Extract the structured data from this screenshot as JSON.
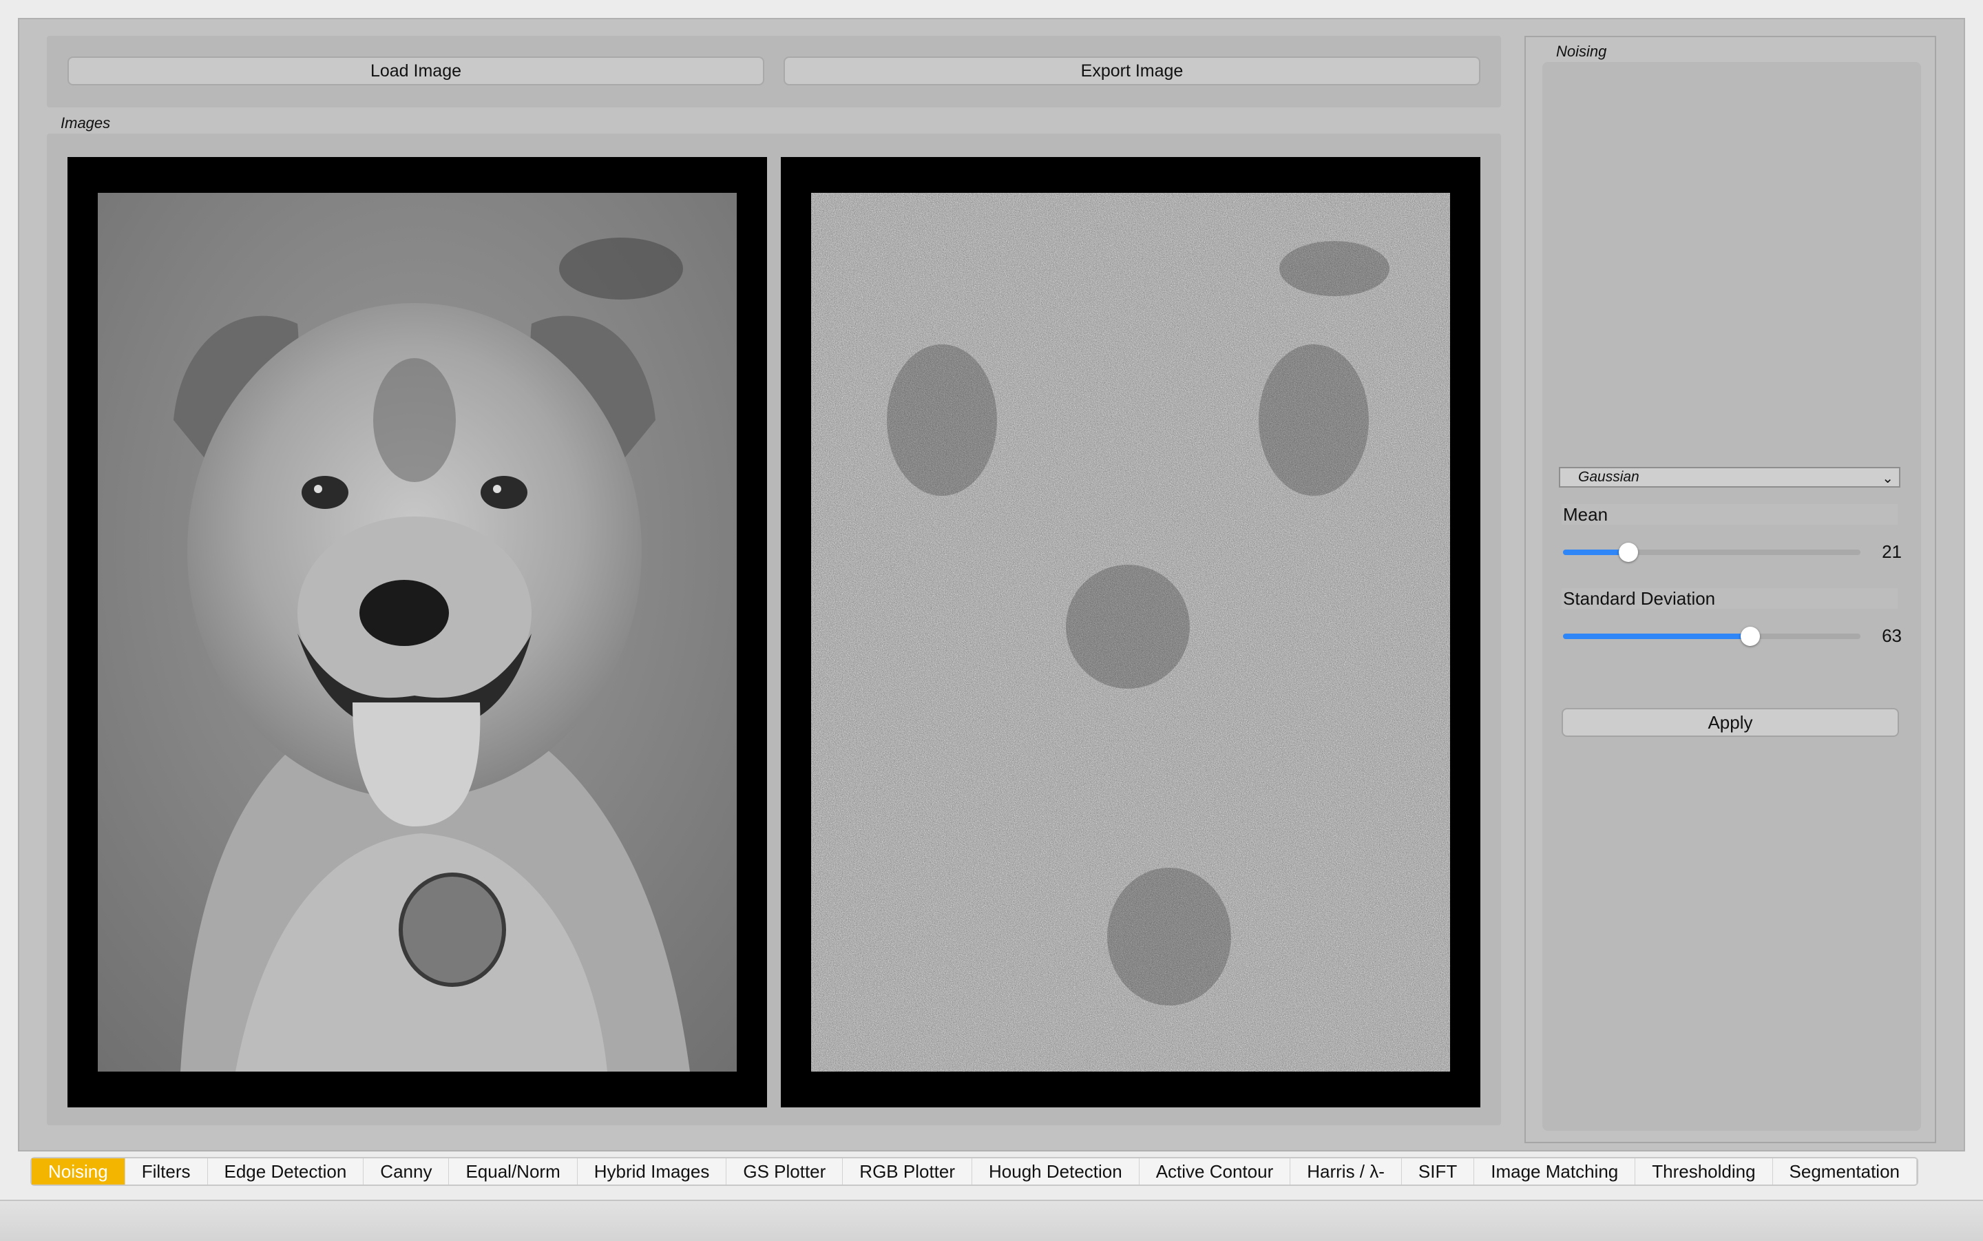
{
  "toolbar": {
    "load_label": "Load Image",
    "export_label": "Export Image"
  },
  "images_group": {
    "label": "Images"
  },
  "noising_panel": {
    "title": "Noising",
    "noise_type": "Gaussian",
    "mean": {
      "label": "Mean",
      "value": "21",
      "fraction": 0.22
    },
    "std": {
      "label": "Standard Deviation",
      "value": "63",
      "fraction": 0.63
    },
    "apply_label": "Apply"
  },
  "tabs": [
    {
      "label": "Noising"
    },
    {
      "label": "Filters"
    },
    {
      "label": "Edge Detection"
    },
    {
      "label": "Canny"
    },
    {
      "label": "Equal/Norm"
    },
    {
      "label": "Hybrid Images"
    },
    {
      "label": "GS Plotter"
    },
    {
      "label": "RGB Plotter"
    },
    {
      "label": "Hough Detection"
    },
    {
      "label": "Active Contour"
    },
    {
      "label": "Harris / λ-"
    },
    {
      "label": "SIFT"
    },
    {
      "label": "Image Matching"
    },
    {
      "label": "Thresholding"
    },
    {
      "label": "Segmentation"
    }
  ],
  "active_tab": "Noising",
  "colors": {
    "active_tab": "#f3b500",
    "slider_accent": "#2f86f6"
  }
}
